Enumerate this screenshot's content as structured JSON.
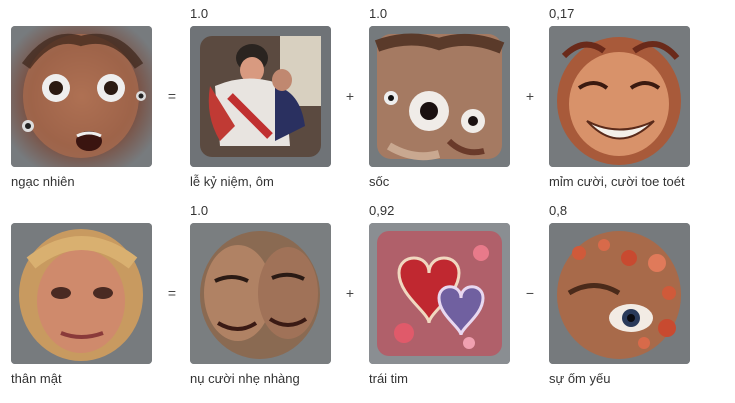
{
  "rows": [
    {
      "target": {
        "label": "ngạc nhiên",
        "icon": "surprised-face-image"
      },
      "eq": "=",
      "terms": [
        {
          "coef": "1.0",
          "label": "lễ kỷ niệm, ôm",
          "icon": "celebration-hug-image"
        },
        {
          "op": "+",
          "coef": "1.0",
          "label": "sốc",
          "icon": "shocked-face-image"
        },
        {
          "op": "+",
          "coef": "0,17",
          "label": "mỉm cười, cười toe toét",
          "icon": "smiling-face-image"
        }
      ]
    },
    {
      "target": {
        "label": "thân mật",
        "icon": "intimate-face-image"
      },
      "eq": "=",
      "terms": [
        {
          "coef": "1.0",
          "label": "nụ cười nhẹ nhàng",
          "icon": "gentle-smile-image"
        },
        {
          "op": "+",
          "coef": "0,92",
          "label": "trái tim",
          "icon": "heart-love-image"
        },
        {
          "op": "−",
          "coef": "0,8",
          "label": "sự ốm yếu",
          "icon": "sickness-face-image"
        }
      ]
    }
  ],
  "colors": {
    "frame": "#787c7f",
    "text": "#333333"
  }
}
